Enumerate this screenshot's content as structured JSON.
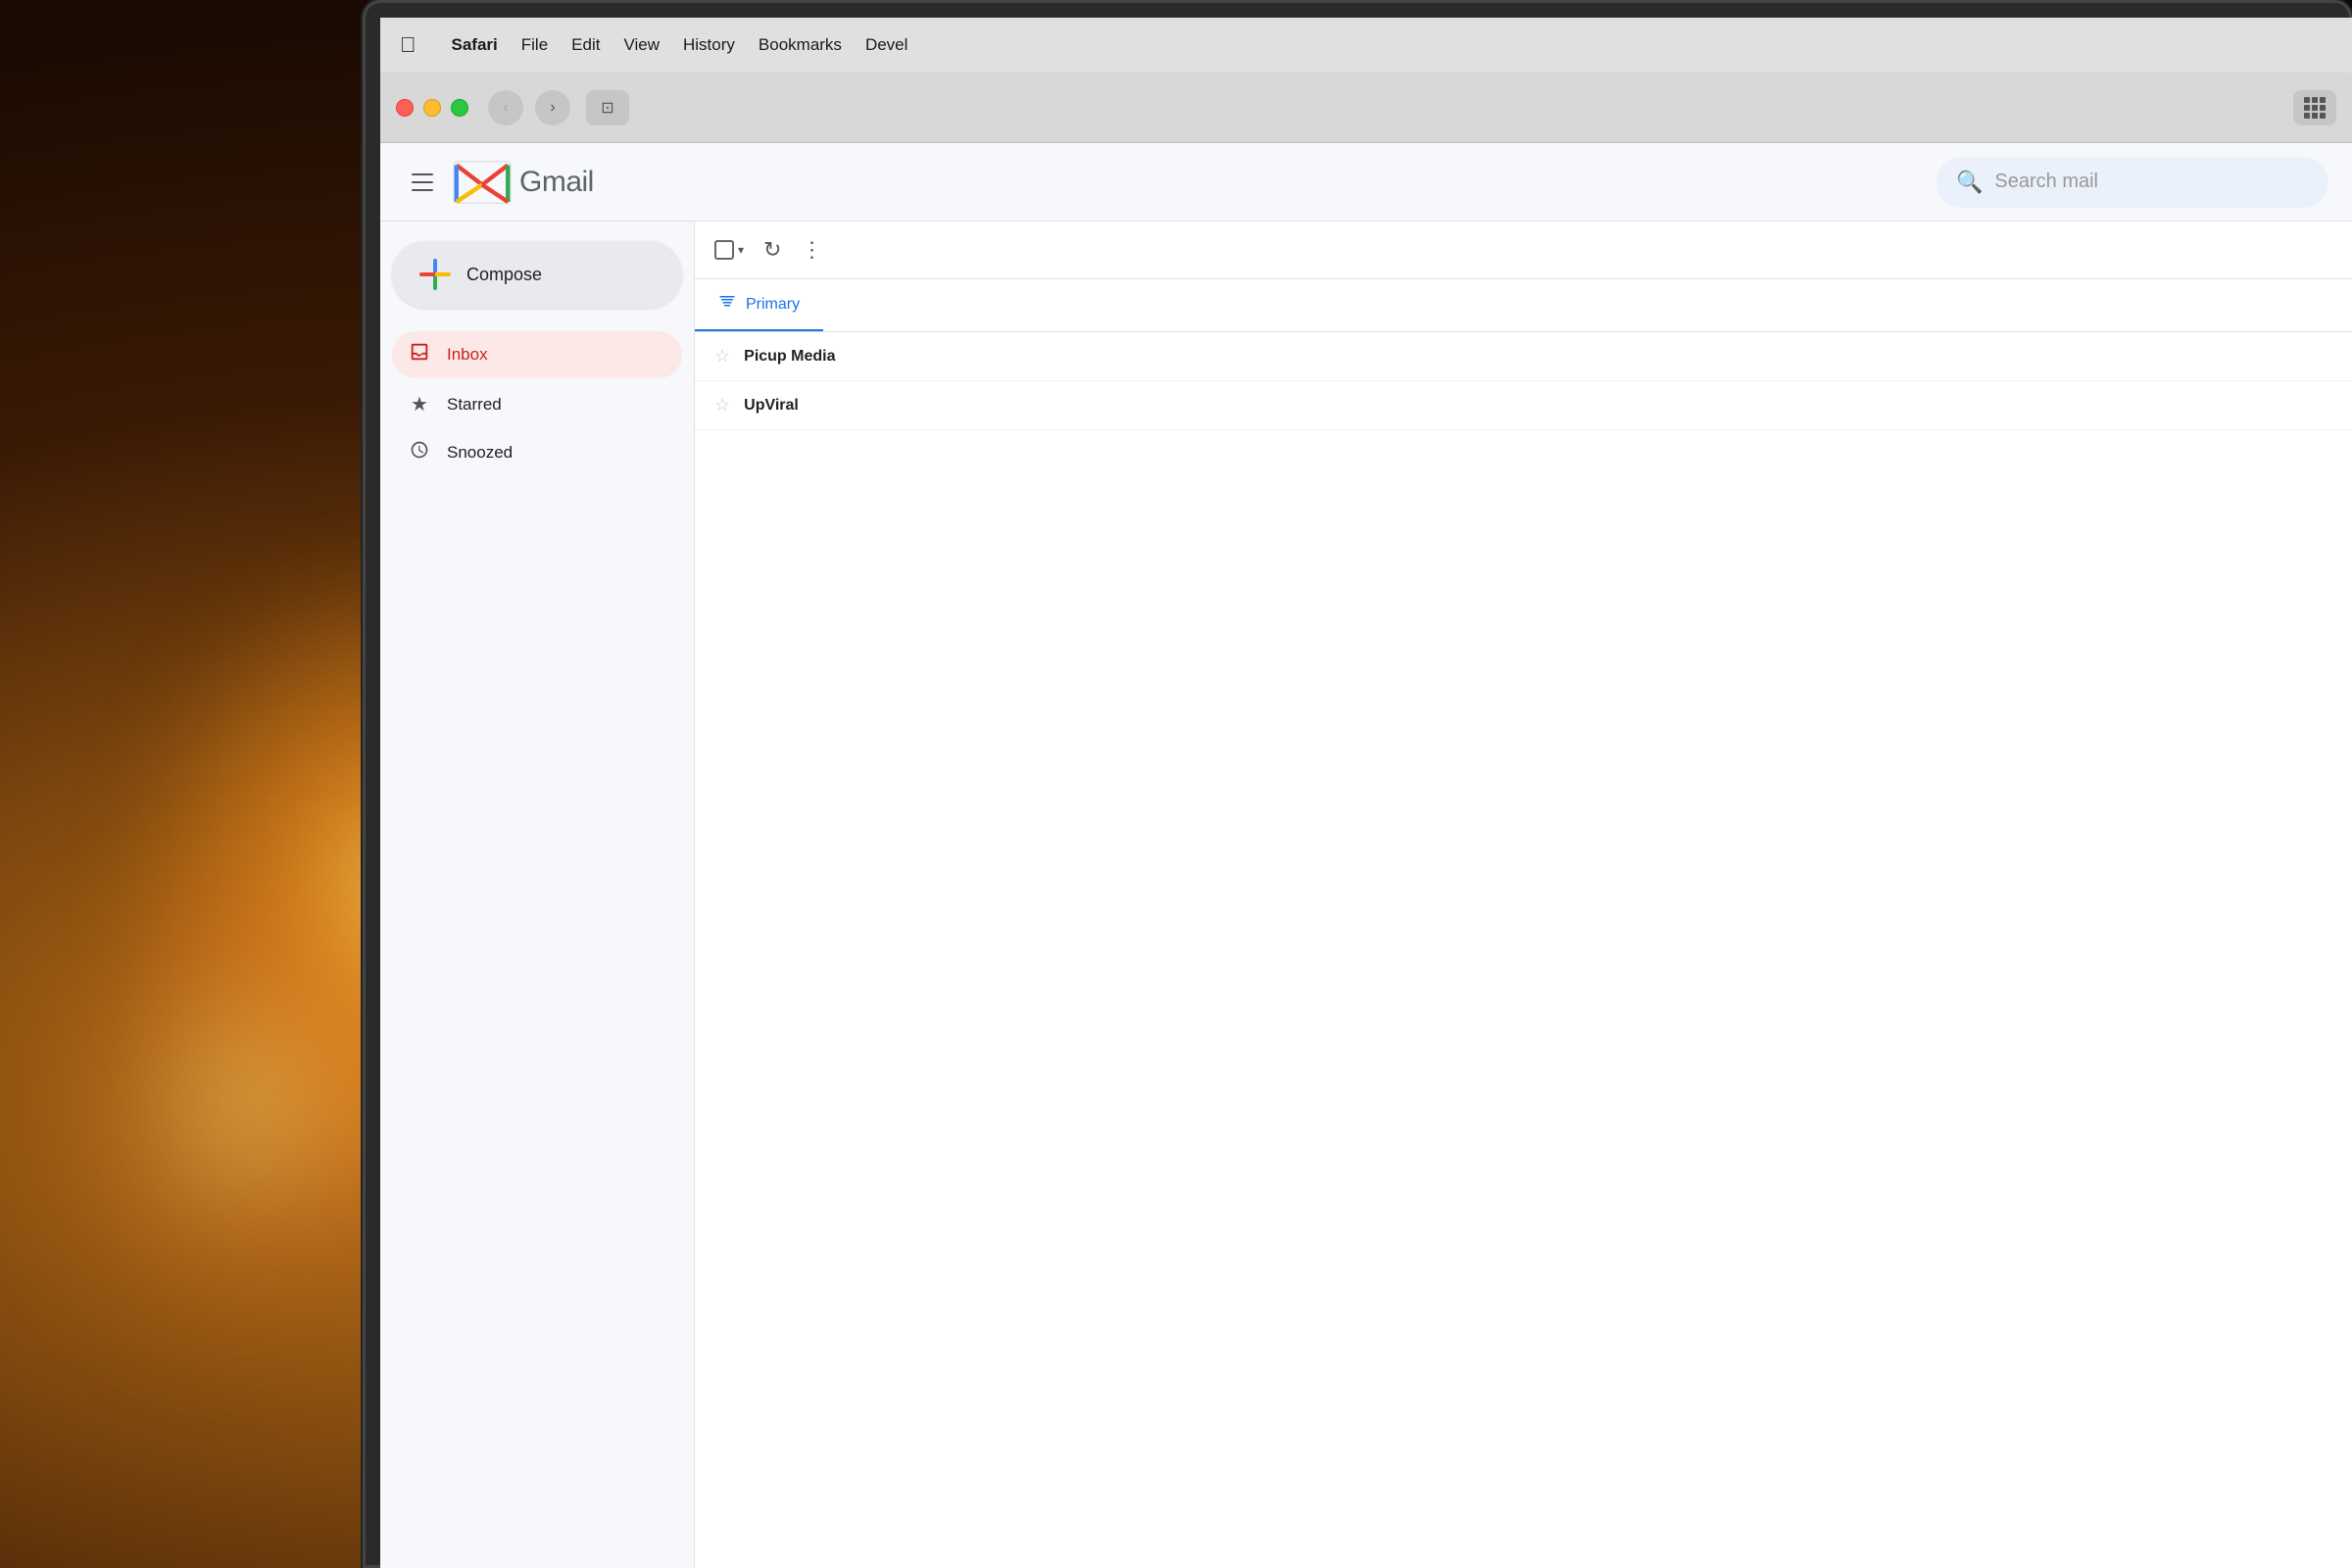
{
  "background": {
    "description": "warm bokeh background with orange/amber light"
  },
  "macos": {
    "menubar": {
      "apple_symbol": "&#63743;",
      "items": [
        {
          "label": "Safari",
          "bold": true
        },
        {
          "label": "File",
          "bold": false
        },
        {
          "label": "Edit",
          "bold": false
        },
        {
          "label": "View",
          "bold": false
        },
        {
          "label": "History",
          "bold": false
        },
        {
          "label": "Bookmarks",
          "bold": false
        },
        {
          "label": "Devel",
          "bold": false
        }
      ]
    },
    "browser": {
      "back_btn": "‹",
      "forward_btn": "›",
      "sidebar_icon": "⊡"
    }
  },
  "gmail": {
    "header": {
      "menu_icon": "☰",
      "logo_text": "Gmail",
      "search_placeholder": "Search mail"
    },
    "sidebar": {
      "compose_label": "Compose",
      "nav_items": [
        {
          "id": "inbox",
          "label": "Inbox",
          "icon": "inbox",
          "active": true
        },
        {
          "id": "starred",
          "label": "Starred",
          "icon": "star"
        },
        {
          "id": "snoozed",
          "label": "Snoozed",
          "icon": "clock"
        }
      ]
    },
    "email_list": {
      "toolbar": {
        "refresh_icon": "↻",
        "more_icon": "⋮"
      },
      "tabs": [
        {
          "id": "primary",
          "label": "Primary",
          "icon": "☐",
          "active": true
        }
      ],
      "emails": [
        {
          "id": 1,
          "sender": "Picup Media",
          "preview": ""
        },
        {
          "id": 2,
          "sender": "UpViral",
          "preview": ""
        }
      ]
    }
  }
}
